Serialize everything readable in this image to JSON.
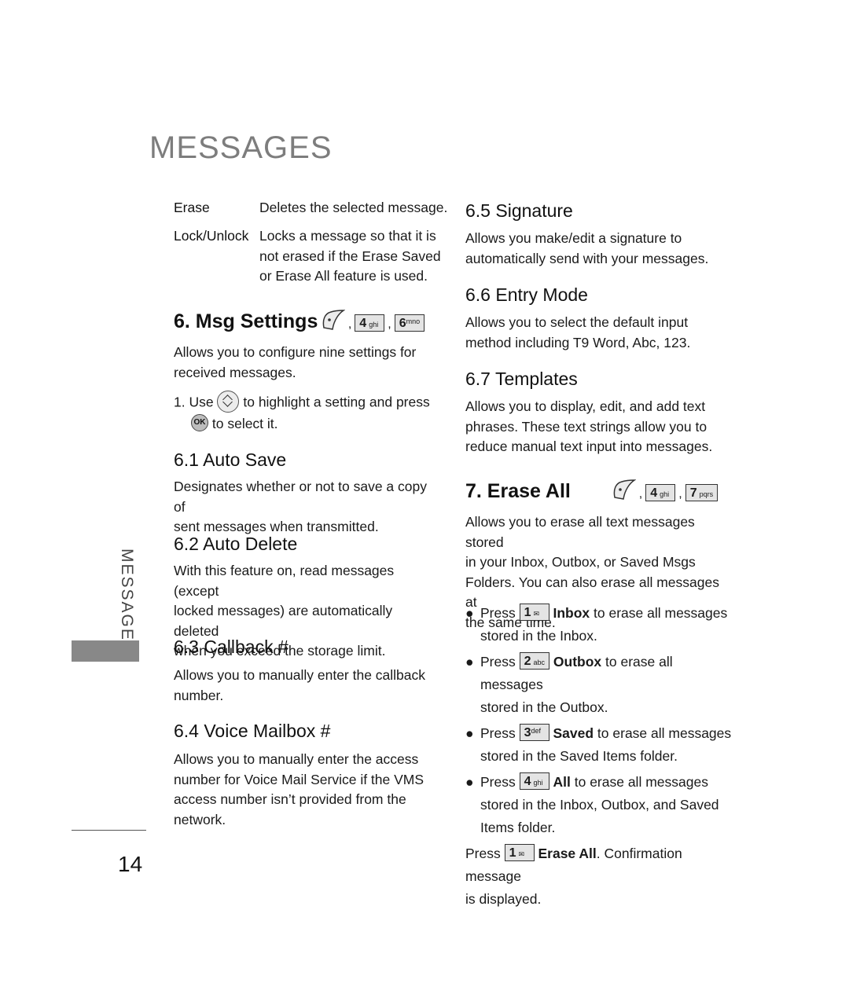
{
  "header": {
    "title": "MESSAGES"
  },
  "sidebar": {
    "section_label": "MESSAGES"
  },
  "footer": {
    "page_number": "14"
  },
  "definitions": [
    {
      "term": "Erase",
      "desc": "Deletes the selected message."
    },
    {
      "term": "Lock/Unlock",
      "desc_lines": [
        "Locks a message so that it is",
        "not erased if the Erase Saved",
        "or Erase All feature is used."
      ]
    }
  ],
  "keys": {
    "left_soft": "left-softkey-icon",
    "k1": {
      "num": "1",
      "sub": "✉"
    },
    "k2": {
      "num": "2",
      "sub": "abc"
    },
    "k3": {
      "num": "3",
      "sub": "def"
    },
    "k4": {
      "num": "4",
      "sub": "ghi"
    },
    "k6": {
      "num": "6",
      "sub": "mno"
    },
    "k7": {
      "num": "7",
      "sub": "pqrs"
    },
    "ok": "OK"
  },
  "msg_settings": {
    "heading": "6. Msg Settings",
    "comma": ",",
    "body_lines": [
      "Allows you to configure nine settings for",
      "received messages."
    ],
    "step": {
      "num": "1.",
      "pre": "Use",
      "mid": "to highlight a setting and press",
      "post": "to select it."
    }
  },
  "sections": [
    {
      "id": "auto-save",
      "heading": "6.1 Auto Save",
      "lines": [
        "Designates whether or not to save a copy of",
        "sent messages when transmitted."
      ]
    },
    {
      "id": "auto-delete",
      "heading": "6.2 Auto Delete",
      "lines": [
        "With this feature on, read messages (except",
        "locked messages) are automatically deleted",
        "when you exceed the storage limit."
      ]
    },
    {
      "id": "callback",
      "heading": "6.3 Callback #",
      "lines": [
        "Allows you to manually enter the callback",
        "number."
      ]
    },
    {
      "id": "voice-mailbox",
      "heading": "6.4 Voice Mailbox #",
      "lines": [
        "Allows you to manually enter the access",
        "number for Voice Mail Service if the VMS",
        "access number isn’t provided from the",
        "network."
      ]
    },
    {
      "id": "signature",
      "heading": "6.5 Signature",
      "lines": [
        "Allows you make/edit a signature to",
        "automatically send with your messages."
      ]
    },
    {
      "id": "entry-mode",
      "heading": "6.6 Entry Mode",
      "lines": [
        "Allows you to select the default input",
        "method including T9 Word, Abc, 123."
      ]
    },
    {
      "id": "templates",
      "heading": "6.7 Templates",
      "lines": [
        "Allows you to display, edit, and add text",
        "phrases. These text strings allow you to",
        "reduce manual text input into messages."
      ]
    }
  ],
  "erase_all": {
    "heading": "7. Erase All",
    "lines": [
      "Allows you to erase all text messages stored",
      "in your Inbox, Outbox, or Saved Msgs",
      "Folders. You can also erase all messages at",
      "the same time."
    ],
    "bullets": [
      {
        "press": "Press",
        "bold": "Inbox",
        "rest": "to erase all messages",
        "cont": [
          "stored in the Inbox."
        ]
      },
      {
        "press": "Press",
        "bold": "Outbox",
        "rest": "to erase all messages",
        "cont": [
          "stored in the Outbox."
        ]
      },
      {
        "press": "Press",
        "bold": "Saved",
        "rest": "to erase all messages",
        "cont": [
          "stored in the Saved Items folder."
        ]
      },
      {
        "press": "Press",
        "bold": "All",
        "rest": "to erase all messages",
        "cont": [
          "stored in the Inbox, Outbox, and Saved",
          "Items folder."
        ]
      }
    ],
    "final": {
      "press": "Press",
      "bold": "Erase All",
      "rest": ". Confirmation message",
      "cont": "is displayed."
    },
    "bullet_char": "●"
  }
}
